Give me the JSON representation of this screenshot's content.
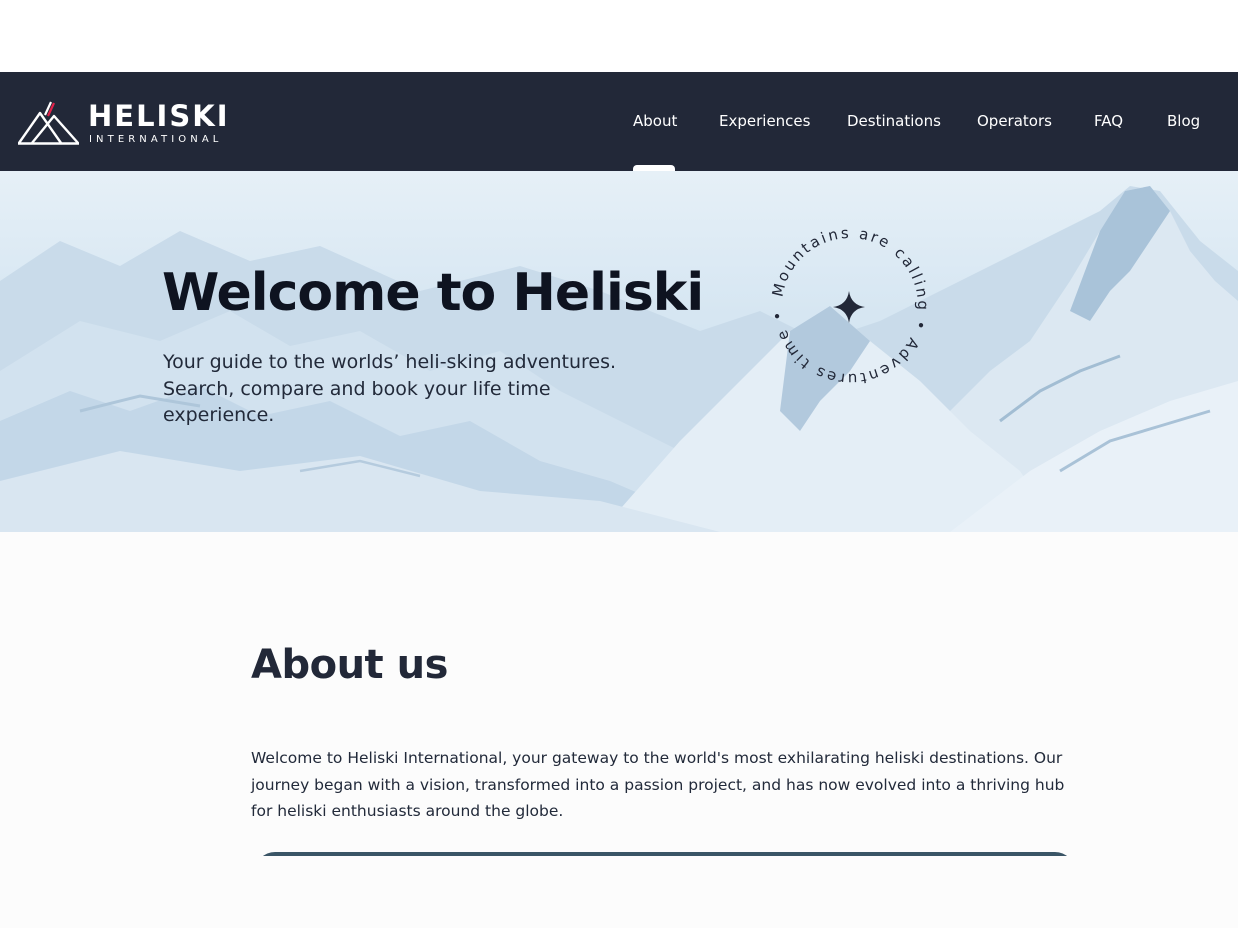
{
  "brand": {
    "name": "HELISKI",
    "tagline": "INTERNATIONAL",
    "accent_color": "#e0224a",
    "nav_bg": "#222838"
  },
  "nav": {
    "items": [
      {
        "label": "About",
        "active": true
      },
      {
        "label": "Experiences",
        "active": false
      },
      {
        "label": "Destinations",
        "active": false
      },
      {
        "label": "Operators",
        "active": false
      },
      {
        "label": "FAQ",
        "active": false
      },
      {
        "label": "Blog",
        "active": false
      }
    ]
  },
  "hero": {
    "title": "Welcome to Heliski",
    "subtitle": "Your guide to the worlds’ heli-sking adventures. Search, compare and book your life time experience.",
    "badge_text": "Mountains are calling • Adventures time •",
    "badge_icon": "sparkle-star-icon"
  },
  "about": {
    "title": "About us",
    "body": "Welcome to Heliski International, your gateway to the world's most exhilarating heliski destinations. Our journey began with a vision, transformed into a passion project, and has now evolved into a thriving hub for heliski enthusiasts around the globe."
  }
}
